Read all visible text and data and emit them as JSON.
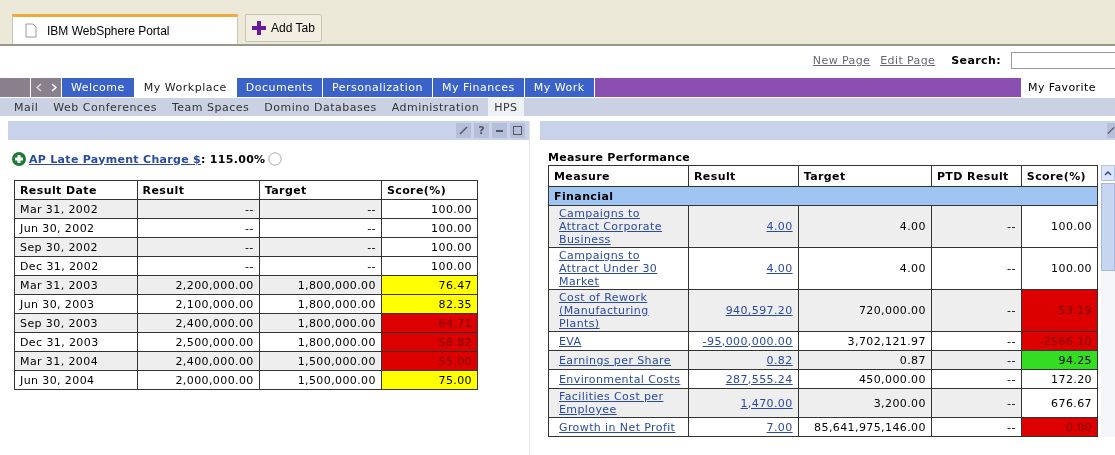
{
  "browser_tabs": [
    {
      "label": "IBM WebSphere Portal",
      "selected": true
    }
  ],
  "add_tab": "Add Tab",
  "header_links": [
    "New Page",
    "Edit Page"
  ],
  "search": {
    "label": "Search:"
  },
  "nav_tabs": [
    {
      "label": "Welcome",
      "selected": false
    },
    {
      "label": "My Workplace",
      "selected": true
    },
    {
      "label": "Documents",
      "selected": false
    },
    {
      "label": "Personalization",
      "selected": false
    },
    {
      "label": "My Finances",
      "selected": false
    },
    {
      "label": "My Work",
      "selected": false
    }
  ],
  "favorites": "My Favorite",
  "sub_tabs": [
    {
      "label": "Mail",
      "selected": false
    },
    {
      "label": "Web Conferences",
      "selected": false
    },
    {
      "label": "Team Spaces",
      "selected": false
    },
    {
      "label": "Domino Databases",
      "selected": false
    },
    {
      "label": "Administration",
      "selected": false
    },
    {
      "label": "HPS",
      "selected": true
    }
  ],
  "left_portlet": {
    "help_button": "?",
    "measure_link": "AP Late Payment Charge $",
    "measure_value": ": 115.00%",
    "table": {
      "columns": [
        "Result Date",
        "Result",
        "Target",
        "Score(%)"
      ],
      "rows": [
        {
          "cells": [
            "Mar 31, 2002",
            "--",
            "--",
            "100.00"
          ]
        },
        {
          "cells": [
            "Jun 30, 2002",
            "--",
            "--",
            "100.00"
          ]
        },
        {
          "cells": [
            "Sep 30, 2002",
            "--",
            "--",
            "100.00"
          ]
        },
        {
          "cells": [
            "Dec 31, 2002",
            "--",
            "--",
            "100.00"
          ]
        },
        {
          "cells": [
            "Mar 31, 2003",
            "2,200,000.00",
            "1,800,000.00",
            "76.47"
          ],
          "color": "#ffff00"
        },
        {
          "cells": [
            "Jun 30, 2003",
            "2,100,000.00",
            "1,800,000.00",
            "82.35"
          ],
          "color": "#ffff00"
        },
        {
          "cells": [
            "Sep 30, 2003",
            "2,400,000.00",
            "1,800,000.00",
            "64.71"
          ],
          "color": "#dd0000"
        },
        {
          "cells": [
            "Dec 31, 2003",
            "2,500,000.00",
            "1,800,000.00",
            "58.82"
          ],
          "color": "#dd0000"
        },
        {
          "cells": [
            "Mar 31, 2004",
            "2,400,000.00",
            "1,500,000.00",
            "55.00"
          ],
          "color": "#dd0000"
        },
        {
          "cells": [
            "Jun 30, 2004",
            "2,000,000.00",
            "1,500,000.00",
            "75.00"
          ],
          "color": "#ffff00"
        }
      ]
    }
  },
  "right_portlet": {
    "title": "Measure Performance",
    "table": {
      "columns": [
        "Measure",
        "Result",
        "Target",
        "PTD Result",
        "Score(%)"
      ],
      "rows": [
        {
          "kind": "group",
          "label": "Financial"
        },
        {
          "kind": "measure",
          "measure": "Campaigns to Attract Corporate Business",
          "result": "4.00",
          "target": "4.00",
          "ptd": "--",
          "score": "100.00"
        },
        {
          "kind": "measure",
          "measure": "Campaigns to Attract Under 30 Market",
          "result": "4.00",
          "target": "4.00",
          "ptd": "--",
          "score": "100.00"
        },
        {
          "kind": "measure",
          "measure": "Cost of Rework (Manufacturing Plants)",
          "result": "940,597.20",
          "target": "720,000.00",
          "ptd": "--",
          "score": "-53.19",
          "color": "#dd0000"
        },
        {
          "kind": "measure",
          "measure": "EVA",
          "result": "-95,000,000.00",
          "target": "3,702,121.97",
          "ptd": "--",
          "score": "-2566.10",
          "color": "#dd0000"
        },
        {
          "kind": "measure",
          "measure": "Earnings per Share",
          "result": "0.82",
          "target": "0.87",
          "ptd": "--",
          "score": "94.25",
          "color": "#33dd22"
        },
        {
          "kind": "measure",
          "measure": "Environmental Costs",
          "result": "287,555.24",
          "target": "450,000.00",
          "ptd": "--",
          "score": "172.20"
        },
        {
          "kind": "measure",
          "measure": "Facilities Cost per Employee",
          "result": "1,470.00",
          "target": "3,200.00",
          "ptd": "--",
          "score": "676.67"
        },
        {
          "kind": "measure",
          "measure": "Growth in Net Profit",
          "result": "7.00",
          "target": "85,641,975,146.00",
          "ptd": "--",
          "score": "0.00",
          "color": "#dd0000"
        }
      ]
    }
  }
}
